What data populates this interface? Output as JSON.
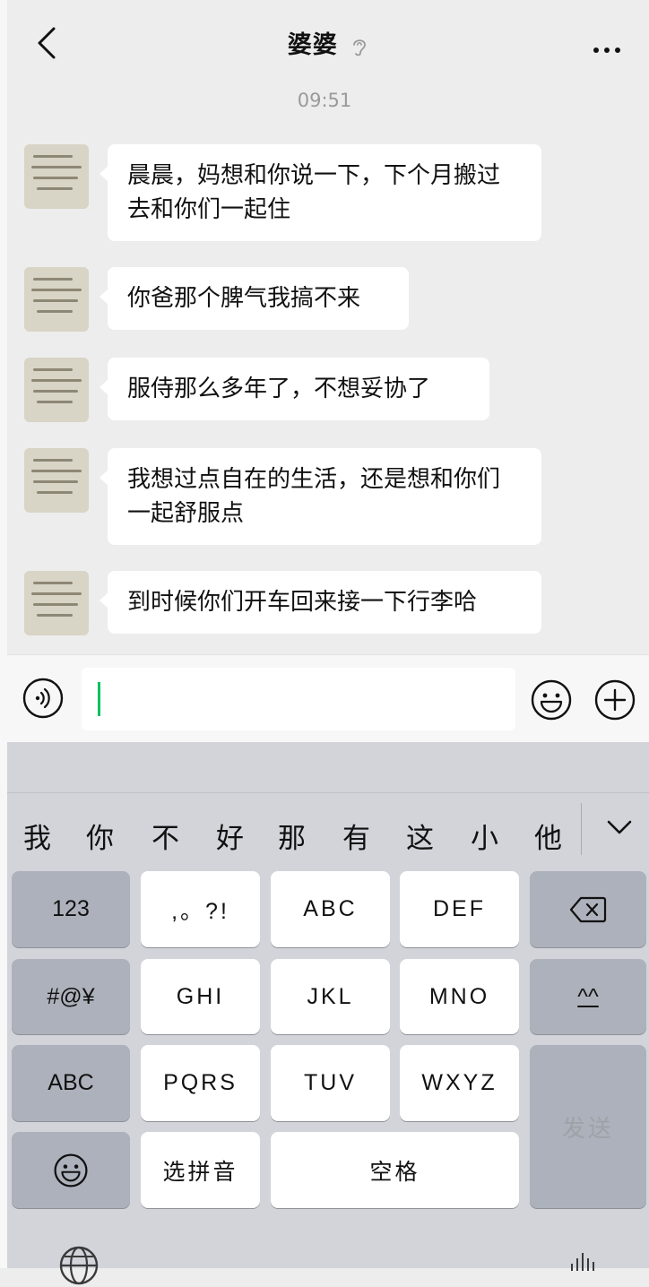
{
  "header": {
    "title": "婆婆",
    "back_icon": "chevron-left-icon",
    "more_icon": "more-dots-icon",
    "ear_icon": "ear-icon"
  },
  "chat": {
    "time": "09:51",
    "messages": [
      {
        "text": "晨晨，妈想和你说一下，下个月搬过去和你们一起住"
      },
      {
        "text": "你爸那个脾气我搞不来"
      },
      {
        "text": "服侍那么多年了，不想妥协了"
      },
      {
        "text": "我想过点自在的生活，还是想和你们一起舒服点"
      },
      {
        "text": "到时候你们开车回来接一下行李哈"
      }
    ]
  },
  "input": {
    "value": "",
    "voice_icon": "voice-icon",
    "emoji_icon": "emoji-icon",
    "plus_icon": "plus-icon"
  },
  "keyboard": {
    "candidates": [
      "我",
      "你",
      "不",
      "好",
      "那",
      "有",
      "这",
      "小",
      "他"
    ],
    "keys": {
      "num": "123",
      "punct": ",。?!",
      "abc": "ABC",
      "def": "DEF",
      "sym": "#@¥",
      "ghi": "GHI",
      "jkl": "JKL",
      "mno": "MNO",
      "kaomoji": "^^",
      "abc_switch": "ABC",
      "pqrs": "PQRS",
      "tuv": "TUV",
      "wxyz": "WXYZ",
      "pinyin": "选拼音",
      "space": "空格",
      "send": "发送"
    },
    "icons": {
      "backspace": "backspace-icon",
      "emoji": "emoji-icon",
      "globe": "globe-icon",
      "dictation": "dictation-icon",
      "collapse": "chevron-down-icon"
    }
  },
  "colors": {
    "accent": "#07c160",
    "chat_bg": "#ededed",
    "keyboard_bg": "#d2d4da"
  }
}
